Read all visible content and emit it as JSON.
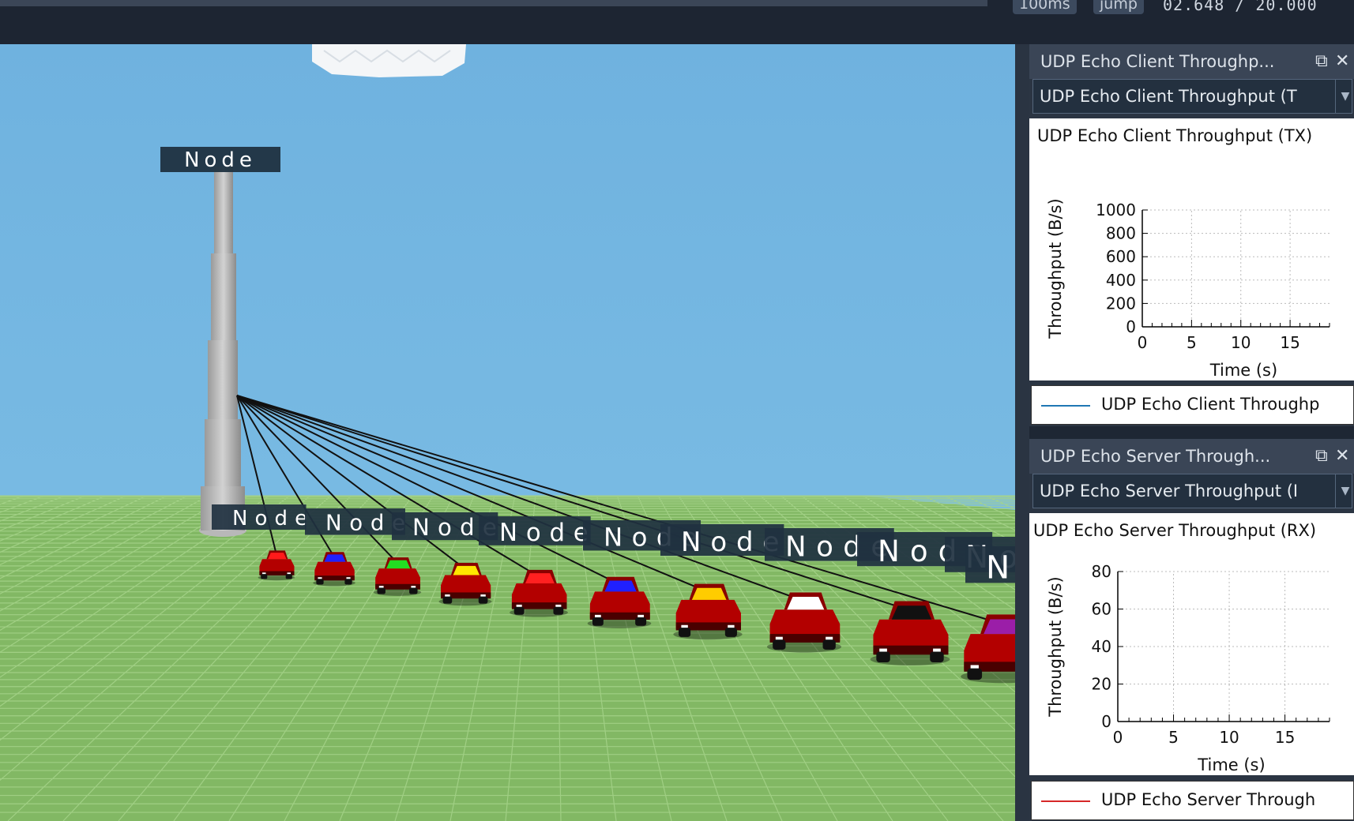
{
  "toolbar": {
    "step_label": "100ms",
    "jump_label": "jump",
    "sim_time": "02.648 / 20.000"
  },
  "scene": {
    "tower_label": "Node",
    "node_label": "Node",
    "car_roof_colors": [
      "#ff1a1a",
      "#2020ff",
      "#22dd22",
      "#ffe600",
      "#ff2020",
      "#2020ff",
      "#ffcc00",
      "#ffffff",
      "#111111",
      "#9b1ea8"
    ],
    "sky_color": "#74b6e0",
    "ground_color": "#82b864"
  },
  "panels": [
    {
      "title": "UDP Echo Client Throughp...",
      "selector": "UDP Echo Client Throughput (T",
      "plot_title": "UDP Echo Client Throughput (TX)",
      "legend": "UDP Echo Client Throughp",
      "legend_color": "#1f77b4",
      "chart_data": {
        "type": "line",
        "xlabel": "Time (s)",
        "ylabel": "Throughput (B/s)",
        "x_ticks": [
          "0",
          "5",
          "10",
          "15"
        ],
        "y_ticks": [
          "0",
          "200",
          "400",
          "600",
          "800",
          "1000"
        ],
        "series": [
          {
            "name": "UDP Echo Client Throughp",
            "x": [],
            "y": []
          }
        ],
        "grid": true
      }
    },
    {
      "title": "UDP Echo Server Through...",
      "selector": "UDP Echo Server Throughput (I",
      "plot_title": "UDP Echo Server Throughput (RX)",
      "legend": "UDP Echo Server Through",
      "legend_color": "#d62728",
      "chart_data": {
        "type": "line",
        "xlabel": "Time (s)",
        "ylabel": "Throughput (B/s)",
        "x_ticks": [
          "0",
          "5",
          "10",
          "15"
        ],
        "y_ticks": [
          "0",
          "20",
          "40",
          "60",
          "80"
        ],
        "series": [
          {
            "name": "UDP Echo Server Through",
            "x": [],
            "y": []
          }
        ],
        "grid": true
      }
    }
  ]
}
